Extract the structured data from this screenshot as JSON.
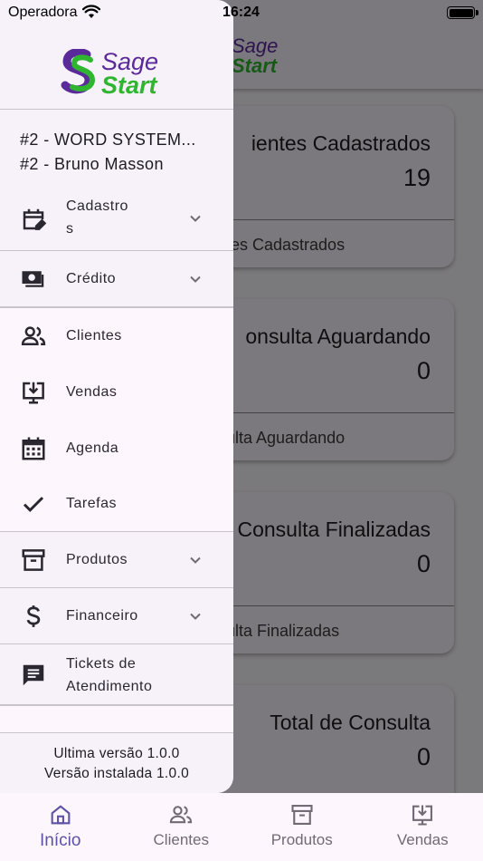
{
  "status_bar": {
    "carrier": "Operadora",
    "time": "16:24"
  },
  "app_bar": {
    "logo_line1": "Sage",
    "logo_line2": "Start"
  },
  "cards": [
    {
      "title": "ientes Cadastrados",
      "value": "19",
      "footer": "tes Cadastrados"
    },
    {
      "title": "onsulta Aguardando",
      "value": "0",
      "footer": "ulta Aguardando"
    },
    {
      "title": "Consulta Finalizadas",
      "value": "0",
      "footer": "ulta Finalizadas"
    },
    {
      "title": "Total de Consulta",
      "value": "0",
      "footer": ""
    }
  ],
  "drawer": {
    "logo_line1": "Sage",
    "logo_line2": "Start",
    "company": "#2 - WORD SYSTEM...",
    "user": "#2 - Bruno Masson",
    "menu": [
      {
        "label": "Cadastro",
        "label2": "s",
        "icon": "calendar-edit-icon",
        "expandable": true
      },
      {
        "label": "Crédito",
        "icon": "money-icon",
        "expandable": true
      },
      {
        "label": "Clientes",
        "icon": "people-icon",
        "expandable": false
      },
      {
        "label": "Vendas",
        "icon": "download-monitor-icon",
        "expandable": false
      },
      {
        "label": "Agenda",
        "icon": "calendar-icon",
        "expandable": false
      },
      {
        "label": "Tarefas",
        "icon": "check-icon",
        "expandable": false
      },
      {
        "label": "Produtos",
        "icon": "archive-icon",
        "expandable": true
      },
      {
        "label": "Financeiro",
        "icon": "dollar-icon",
        "expandable": true
      },
      {
        "label": "Tickets de",
        "label2": "Atendimento",
        "icon": "chat-icon",
        "expandable": false
      }
    ],
    "footer": {
      "latest_version": "Ultima versão 1.0.0",
      "installed_version": "Versão instalada 1.0.0"
    }
  },
  "bottom_nav": {
    "items": [
      {
        "label": "Início",
        "icon": "home-icon",
        "active": true
      },
      {
        "label": "Clientes",
        "icon": "people-icon",
        "active": false
      },
      {
        "label": "Produtos",
        "icon": "archive-icon",
        "active": false
      },
      {
        "label": "Vendas",
        "icon": "download-monitor-icon",
        "active": false
      }
    ]
  },
  "colors": {
    "brand_purple": "#5b2a9a",
    "brand_green": "#2fb52f",
    "active_nav": "#5e52a7"
  }
}
